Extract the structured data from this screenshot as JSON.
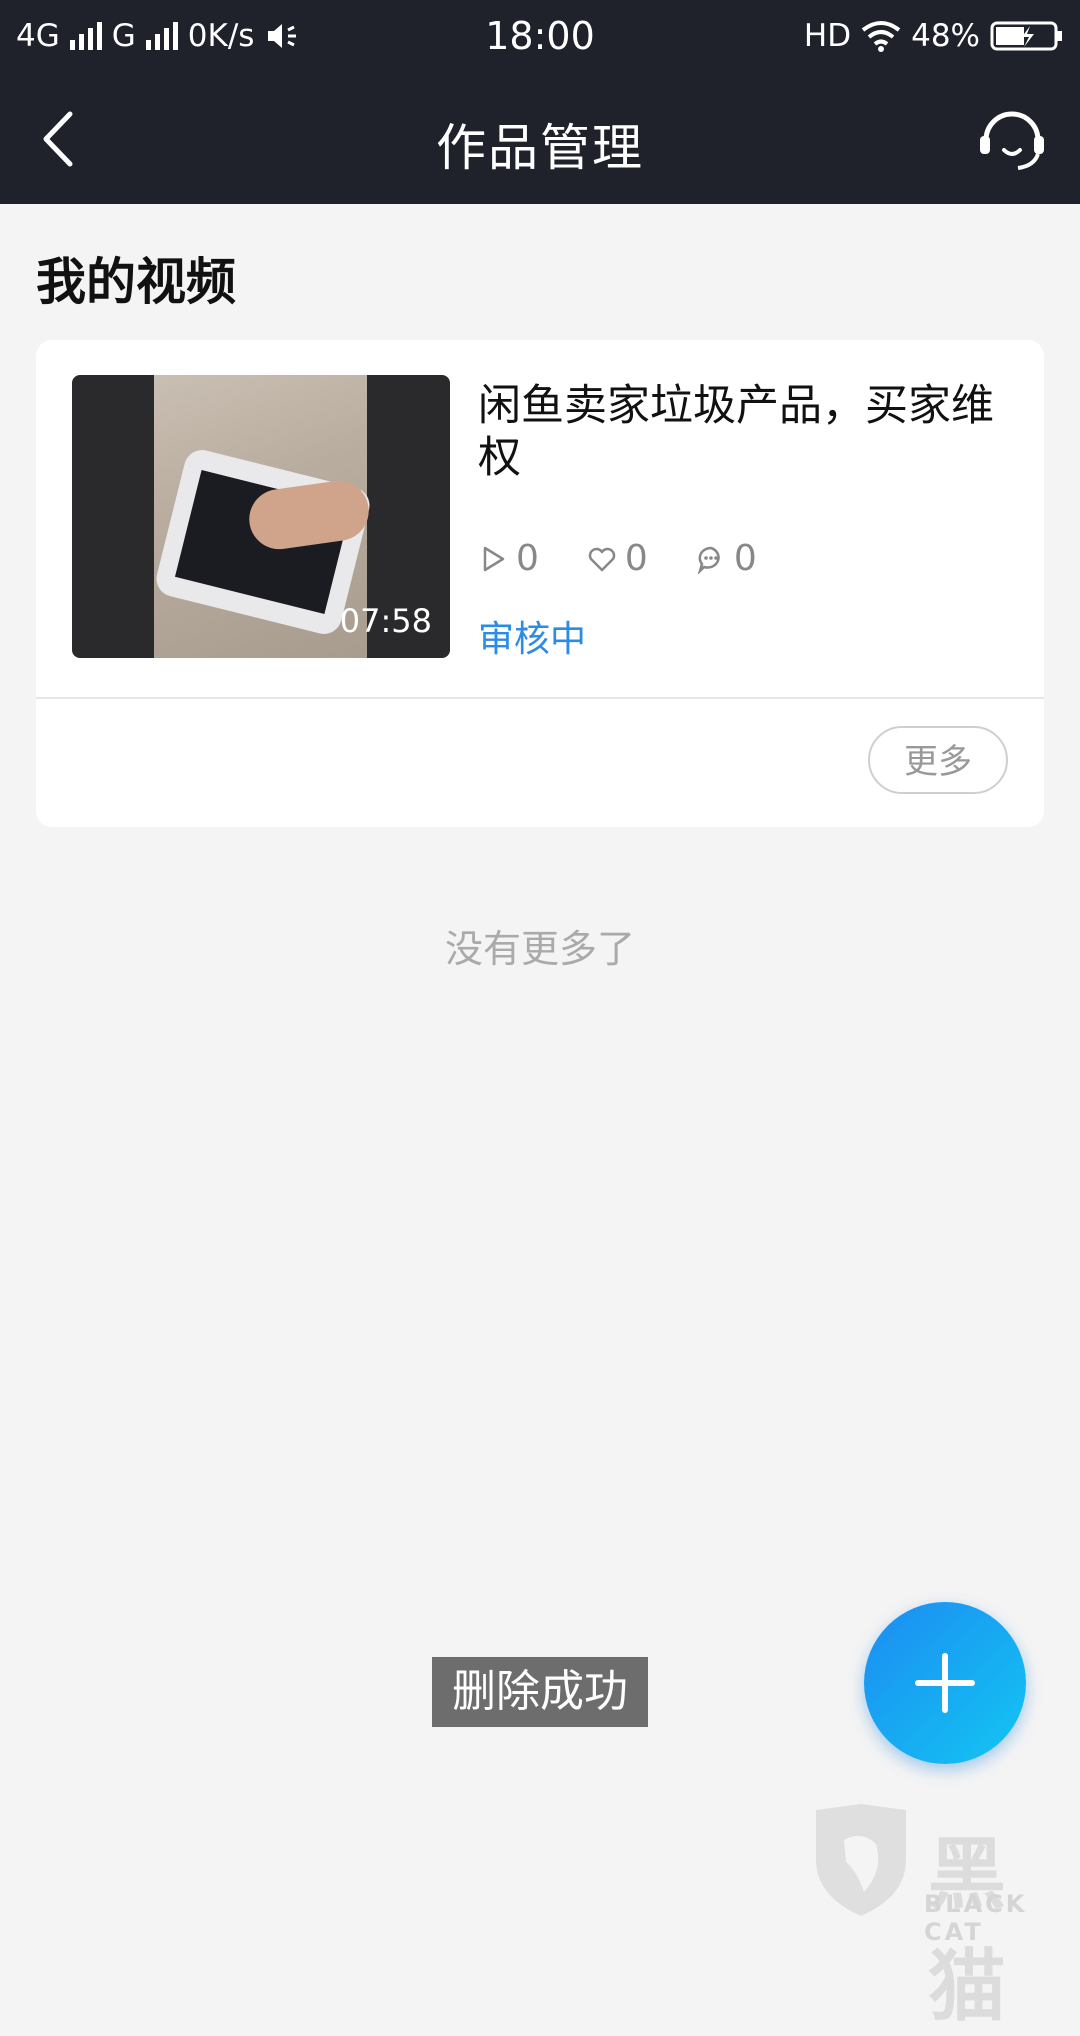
{
  "status_bar": {
    "network1": "4G",
    "network2": "G",
    "speed": "0K/s",
    "time": "18:00",
    "hd": "HD",
    "battery": "48%"
  },
  "nav": {
    "title": "作品管理",
    "icons": {
      "back": "chevron-left-icon",
      "support": "headset-icon"
    }
  },
  "section": {
    "title": "我的视频"
  },
  "video": {
    "title": "闲鱼卖家垃圾产品，买家维权",
    "duration": "07:58",
    "plays": "0",
    "likes": "0",
    "comments": "0",
    "status": "审核中",
    "more_label": "更多"
  },
  "list_footer": "没有更多了",
  "toast": "删除成功",
  "fab": {
    "icon": "plus-icon"
  },
  "watermark": {
    "text": "黑猫",
    "sub": "BLACK CAT"
  },
  "colors": {
    "bar": "#1f222b",
    "accent": "#2b8ce8",
    "fab_start": "#1c8cf2",
    "fab_end": "#13c6f2"
  }
}
